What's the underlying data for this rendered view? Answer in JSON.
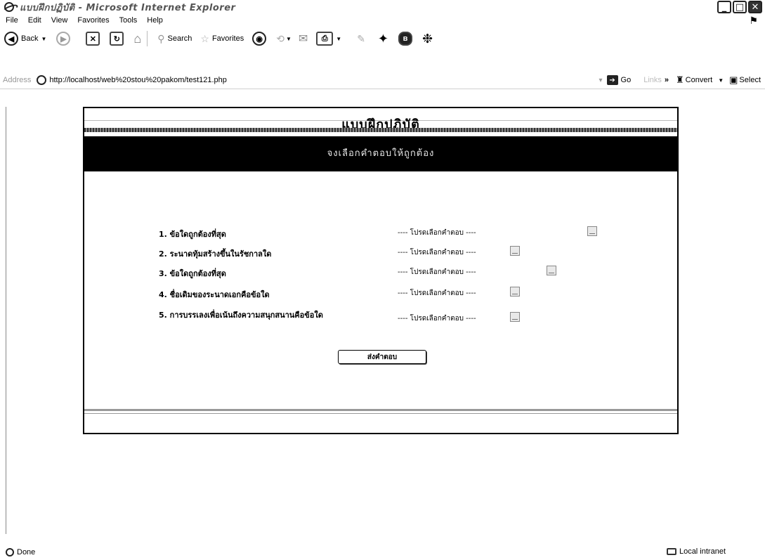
{
  "window": {
    "title": "แบบฝึกปฏิบัติ - Microsoft Internet Explorer"
  },
  "menu": [
    "File",
    "Edit",
    "View",
    "Favorites",
    "Tools",
    "Help"
  ],
  "toolbar": {
    "back": "Back",
    "search": "Search",
    "favorites": "Favorites"
  },
  "address": {
    "label": "Address",
    "url": "http://localhost/web%20stou%20pakom/test121.php",
    "go": "Go",
    "links": "Links",
    "convert": "Convert",
    "select": "Select"
  },
  "page": {
    "title": "แบบฝึกปฏิบัติ",
    "instruction": "จงเลือกคำตอบให้ถูกต้อง",
    "questions": [
      {
        "label": "1. ข้อใดถูกต้องที่สุด",
        "placeholder": "---- โปรดเลือกคำตอบ ----"
      },
      {
        "label": "2. ระนาดทุ้มสร้างขึ้นในรัชกาลใด",
        "placeholder": "---- โปรดเลือกคำตอบ ----"
      },
      {
        "label": "3. ข้อใดถูกต้องที่สุด",
        "placeholder": "---- โปรดเลือกคำตอบ ----"
      },
      {
        "label": "4. ชื่อเดิมของระนาดเอกคือข้อใด",
        "placeholder": "---- โปรดเลือกคำตอบ ----"
      },
      {
        "label": "5. การบรรเลงเพื่อเน้นถึงความสนุกสนานคือข้อใด",
        "placeholder": "---- โปรดเลือกคำตอบ ----"
      }
    ],
    "submit": "ส่งคำตอบ"
  },
  "status": {
    "text": "Done",
    "zone": "Local intranet"
  }
}
